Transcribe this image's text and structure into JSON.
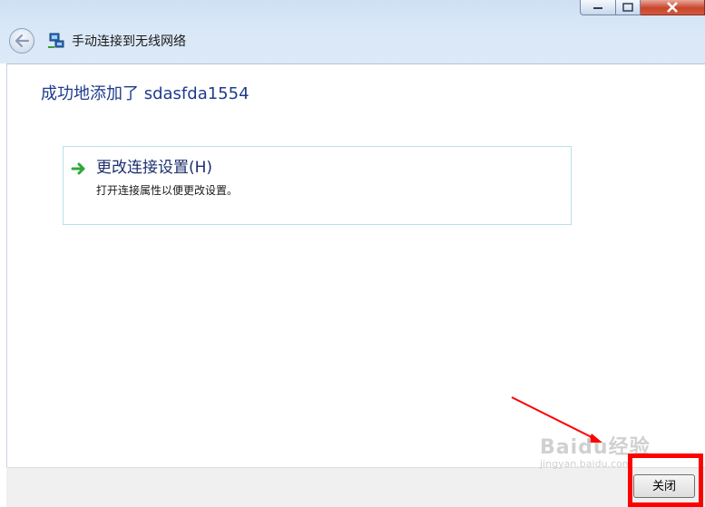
{
  "window": {
    "title": "手动连接到无线网络"
  },
  "content": {
    "heading": "成功地添加了 sdasfda1554",
    "option": {
      "title": "更改连接设置(H)",
      "description": "打开连接属性以便更改设置。"
    }
  },
  "footer": {
    "close_label": "关闭"
  },
  "watermark": {
    "brand": "Baidu经验",
    "url": "jingyan.baidu.com"
  },
  "colors": {
    "heading": "#1e3c8c",
    "highlight": "#ff0000",
    "link_border": "#b8e0e8"
  }
}
